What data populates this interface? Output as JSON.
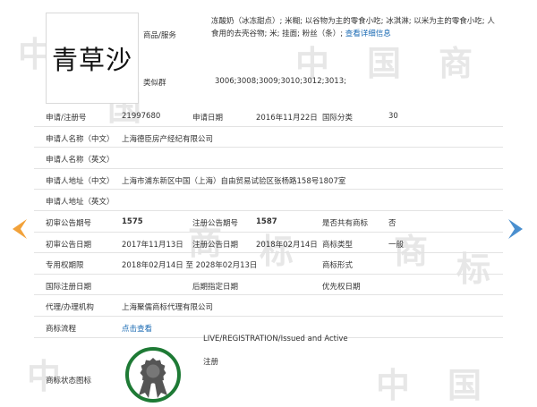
{
  "trademark": {
    "logo_text": "青草沙",
    "goods_label": "商品/服务",
    "goods_text": "冻酸奶（冰冻甜点）; 米糊; 以谷物为主的零食小吃; 冰淇淋; 以米为主的零食小吃; 人食用的去壳谷物; 米; 挂面; 粉丝（条）; ",
    "goods_link": "查看详细信息",
    "similar_label": "类似群",
    "similar_value": "3006;3008;3009;3010;3012;3013;"
  },
  "fields": {
    "reg_no_label": "申请/注册号",
    "reg_no": "21997680",
    "apply_date_label": "申请日期",
    "apply_date": "2016年11月22日",
    "intl_class_label": "国际分类",
    "intl_class": "30",
    "applicant_cn_label": "申请人名称（中文）",
    "applicant_cn": "上海德臣房产经纪有限公司",
    "applicant_en_label": "申请人名称（英文）",
    "applicant_en": "",
    "address_cn_label": "申请人地址（中文）",
    "address_cn": "上海市浦东新区中国（上海）自由贸易试验区张杨路158号1807室",
    "address_en_label": "申请人地址（英文）",
    "address_en": "",
    "prelim_no_label": "初审公告期号",
    "prelim_no": "1575",
    "reg_notice_no_label": "注册公告期号",
    "reg_notice_no": "1587",
    "shared_label": "是否共有商标",
    "shared_value": "否",
    "prelim_date_label": "初审公告日期",
    "prelim_date": "2017年11月13日",
    "reg_date_label": "注册公告日期",
    "reg_date": "2018年02月14日",
    "mark_type_label": "商标类型",
    "mark_type": "一般",
    "exclusive_label": "专用权期限",
    "exclusive_period": "2018年02月14日 至 2028年02月13日",
    "mark_form_label": "商标形式",
    "mark_form": "",
    "intl_reg_date_label": "国际注册日期",
    "intl_reg_date": "",
    "later_date_label": "后期指定日期",
    "later_date": "",
    "priority_date_label": "优先权日期",
    "priority_date": "",
    "agent_label": "代理/办理机构",
    "agent": "上海聚儒商标代理有限公司",
    "process_label": "商标流程",
    "process_link": "点击查看",
    "status_icon_label": "商标状态图标",
    "status_en": "LIVE/REGISTRATION/Issued and Active",
    "status_cn": "注册"
  },
  "watermark": [
    "中",
    "国",
    "商",
    "标"
  ],
  "colors": {
    "link": "#1a6ab3",
    "arrow_left": "#f2a23a",
    "arrow_right": "#4a8fcf",
    "medal_ring": "#1e7a35",
    "medal_body": "#555555"
  }
}
